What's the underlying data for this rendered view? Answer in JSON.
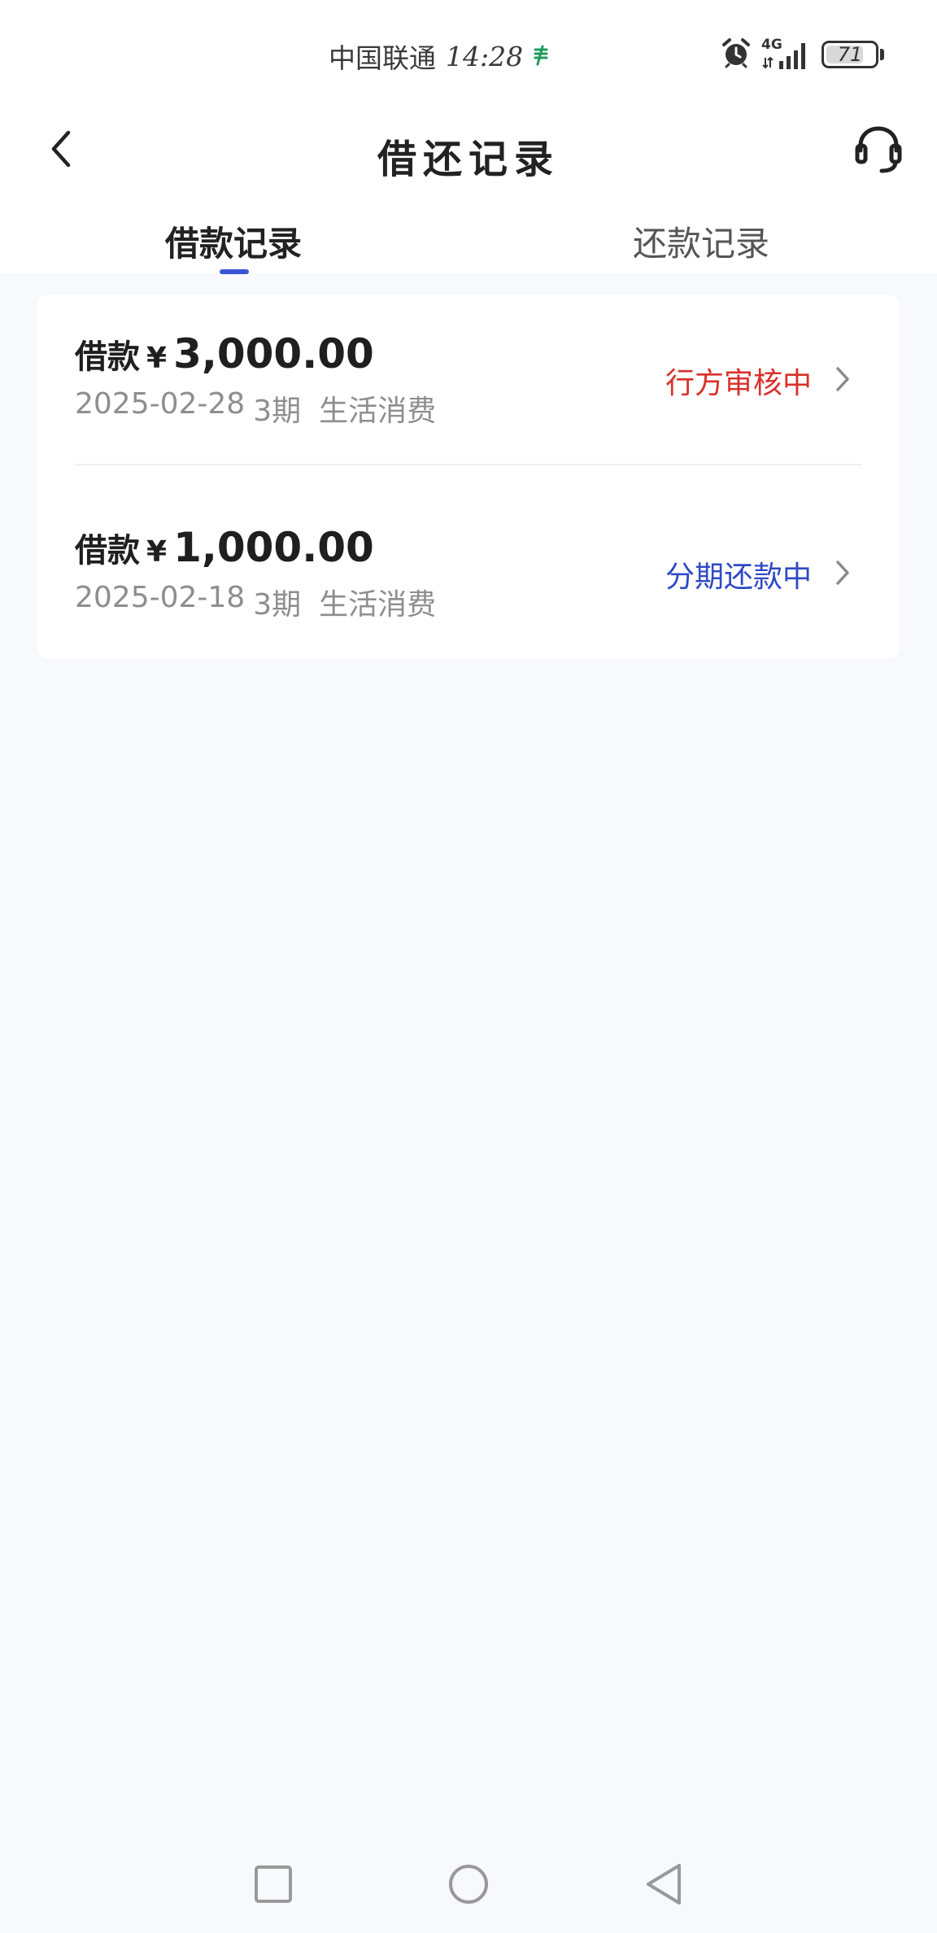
{
  "status_bar": {
    "carrier": "中国联通",
    "time": "14:28",
    "network": "4G",
    "battery": "71"
  },
  "nav": {
    "title": "借还记录"
  },
  "tabs": [
    {
      "label": "借款记录",
      "active": true
    },
    {
      "label": "还款记录",
      "active": false
    }
  ],
  "records": [
    {
      "prefix": "借款",
      "currency": "¥",
      "amount": "3,000.00",
      "date": "2025-02-28",
      "term": "3期",
      "purpose": "生活消费",
      "status": "行方审核中",
      "status_color": "#d9302b"
    },
    {
      "prefix": "借款",
      "currency": "¥",
      "amount": "1,000.00",
      "date": "2025-02-18",
      "term": "3期",
      "purpose": "生活消费",
      "status": "分期还款中",
      "status_color": "#2f49c4"
    }
  ],
  "colors": {
    "accent": "#3a56d4",
    "page_bg": "#f8f9fd"
  }
}
